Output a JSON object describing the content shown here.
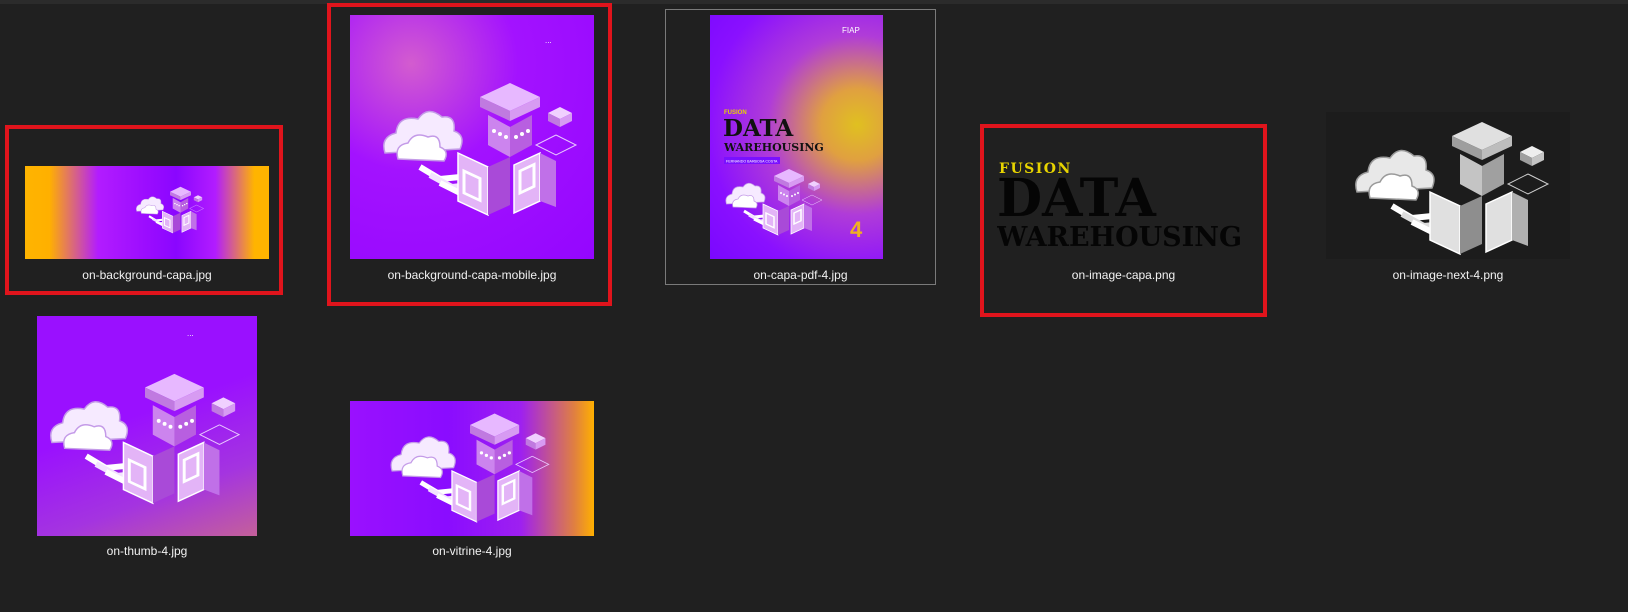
{
  "files": [
    {
      "name": "on-background-capa.jpg"
    },
    {
      "name": "on-background-capa-mobile.jpg"
    },
    {
      "name": "on-capa-pdf-4.jpg"
    },
    {
      "name": "on-image-capa.png"
    },
    {
      "name": "on-image-next-4.png"
    },
    {
      "name": "on-thumb-4.jpg"
    },
    {
      "name": "on-vitrine-4.jpg"
    }
  ],
  "cover": {
    "kicker": "FUSION",
    "title_line1": "DATA",
    "title_line2": "WAREHOUSING",
    "author": "FERNANDO BARBOSA COSTA",
    "number": "4",
    "logo_text": "FIAP"
  },
  "colors": {
    "background": "#202020",
    "highlight": "#e0141c",
    "purple": "#9b0cff",
    "yellow": "#ffb400",
    "fusion_yellow": "#e8d400"
  },
  "highlighted": [
    "on-background-capa.jpg",
    "on-background-capa-mobile.jpg",
    "on-image-capa.png"
  ],
  "selected": "on-capa-pdf-4.jpg"
}
